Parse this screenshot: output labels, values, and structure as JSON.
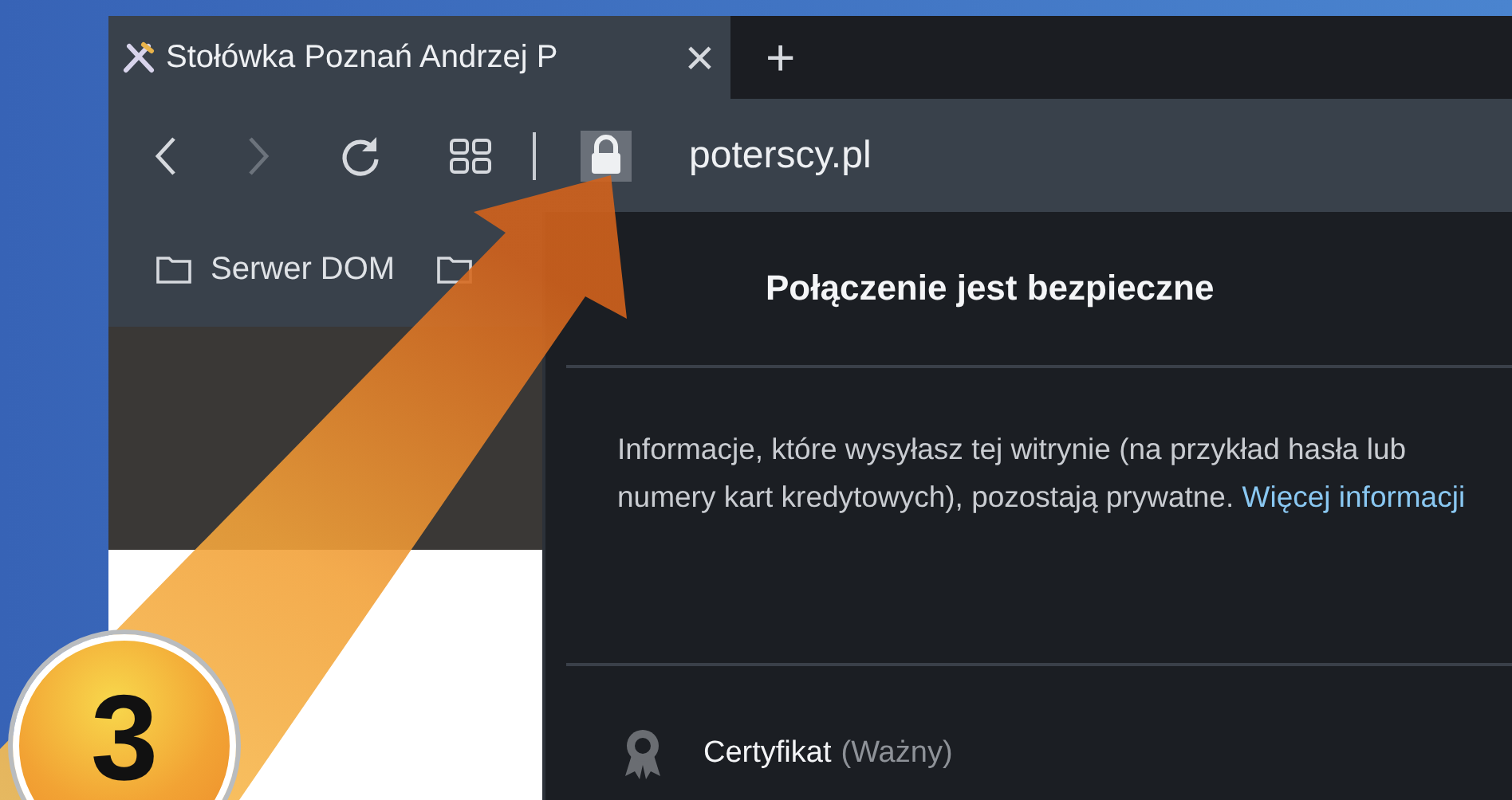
{
  "tab": {
    "title": "Stołówka Poznań Andrzej P",
    "close": "×",
    "selected": true
  },
  "new_tab": "+",
  "address": "poterscy.pl",
  "bookmarks": [
    {
      "label": "Serwer DOM"
    }
  ],
  "popup": {
    "title": "Połączenie jest bezpieczne",
    "description": "Informacje, które wysyłasz tej witrynie (na przykład hasła lub numery kart kredytowych), pozostają prywatne.",
    "link": "Więcej informacji",
    "certificate": {
      "label": "Certyfikat",
      "status": "(Ważny)"
    }
  },
  "step_badge": "3"
}
